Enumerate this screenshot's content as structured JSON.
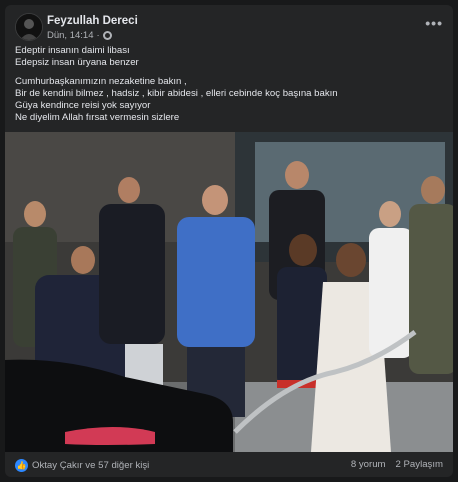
{
  "post": {
    "author": "Feyzullah Dereci",
    "time": "Dün, 14:14",
    "dot": "·",
    "more": "•••",
    "lines": [
      "Edeptir insanın daimi libası",
      "Edepsiz insan üryana benzer",
      "",
      "Cumhurbaşkanımızın nezaketine bakın ,",
      "Bir de kendini bilmez , hadsiz , kibir  abidesi , elleri cebinde koç başına bakın",
      "Güya kendince reisi yok sayıyor",
      "Ne diyelim Allah fırsat vermesin sizlere"
    ]
  },
  "reactions": {
    "icon": "like-icon",
    "text": "Oktay Çakır ve 57 diğer kişi",
    "comments": "8 yorum",
    "shares": "2 Paylaşım"
  },
  "colors": {
    "background": "#18191a",
    "card": "#242526",
    "accent": "#2d88ff"
  }
}
